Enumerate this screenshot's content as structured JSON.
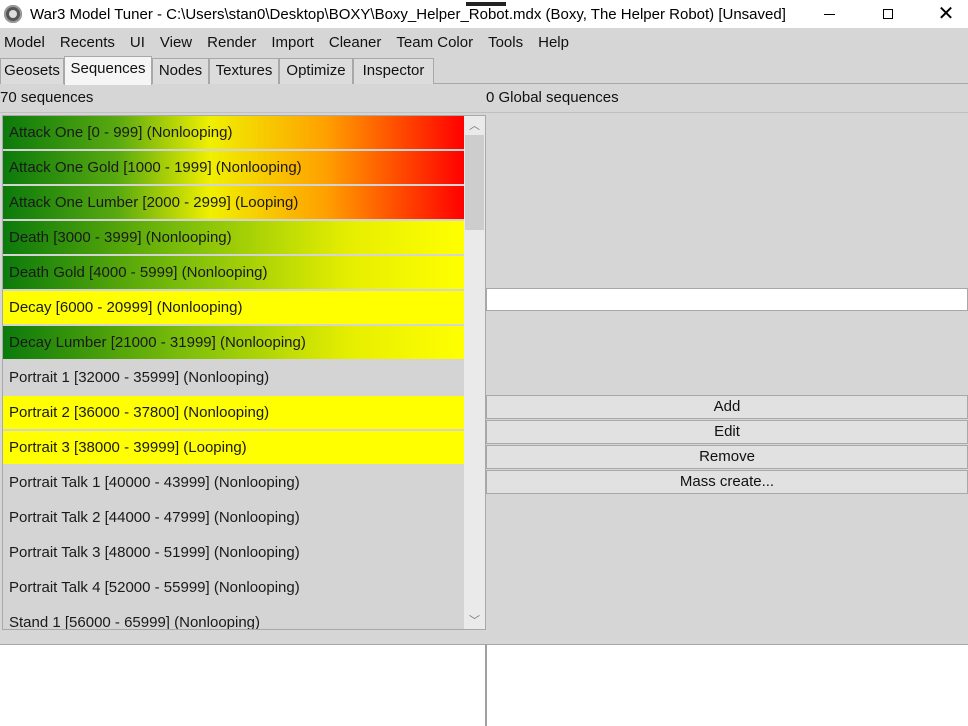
{
  "window": {
    "title": "War3 Model Tuner - C:\\Users\\stan0\\Desktop\\BOXY\\Boxy_Helper_Robot.mdx (Boxy, The Helper Robot) [Unsaved]",
    "app_icon": "app-gear-icon",
    "minimize_icon": "minimize-icon",
    "maximize_icon": "maximize-icon",
    "close_icon": "close-icon",
    "close_glyph": "✕"
  },
  "menu": [
    "Model",
    "Recents",
    "UI",
    "View",
    "Render",
    "Import",
    "Cleaner",
    "Team Color",
    "Tools",
    "Help"
  ],
  "tabs": [
    {
      "label": "Geosets",
      "active": false
    },
    {
      "label": "Sequences",
      "active": true
    },
    {
      "label": "Nodes",
      "active": false
    },
    {
      "label": "Textures",
      "active": false
    },
    {
      "label": "Optimize",
      "active": false
    },
    {
      "label": "Inspector",
      "active": false
    }
  ],
  "sequences_panel": {
    "count_label": "70 sequences",
    "global_count_label": "0 Global sequences",
    "items": [
      {
        "label": "Attack One [0 - 999] (Nonlooping)",
        "style": "g-full"
      },
      {
        "label": "Attack One Gold [1000 - 1999] (Nonlooping)",
        "style": "g-full"
      },
      {
        "label": "Attack One Lumber [2000 - 2999] (Looping)",
        "style": "g-full"
      },
      {
        "label": "Death [3000 - 3999] (Nonlooping)",
        "style": "g-gy"
      },
      {
        "label": "Death Gold [4000 - 5999] (Nonlooping)",
        "style": "g-gy"
      },
      {
        "label": "Decay [6000 - 20999] (Nonlooping)",
        "style": "g-y"
      },
      {
        "label": "Decay Lumber [21000 - 31999] (Nonlooping)",
        "style": "g-gy"
      },
      {
        "label": "Portrait 1 [32000 - 35999] (Nonlooping)",
        "style": "g-none"
      },
      {
        "label": "Portrait 2 [36000 - 37800] (Nonlooping)",
        "style": "g-y"
      },
      {
        "label": "Portrait 3 [38000 - 39999] (Looping)",
        "style": "g-y"
      },
      {
        "label": "Portrait Talk 1 [40000 - 43999] (Nonlooping)",
        "style": "g-none"
      },
      {
        "label": "Portrait Talk 2 [44000 - 47999] (Nonlooping)",
        "style": "g-none"
      },
      {
        "label": "Portrait Talk 3 [48000 - 51999] (Nonlooping)",
        "style": "g-none"
      },
      {
        "label": "Portrait Talk 4 [52000 - 55999] (Nonlooping)",
        "style": "g-none"
      },
      {
        "label": "Stand 1 [56000 - 65999] (Nonlooping)",
        "style": "g-none"
      }
    ],
    "scroll_up_glyph": "︿",
    "scroll_down_glyph": "﹀"
  },
  "global_sequences": {
    "input_value": "",
    "buttons": {
      "add": "Add",
      "edit": "Edit",
      "remove": "Remove",
      "mass_create": "Mass create..."
    }
  },
  "colors": {
    "green": "#0b7a0b",
    "yellow": "#ffff00",
    "red": "#ff0000",
    "panel_bg": "#d6d6d6"
  }
}
